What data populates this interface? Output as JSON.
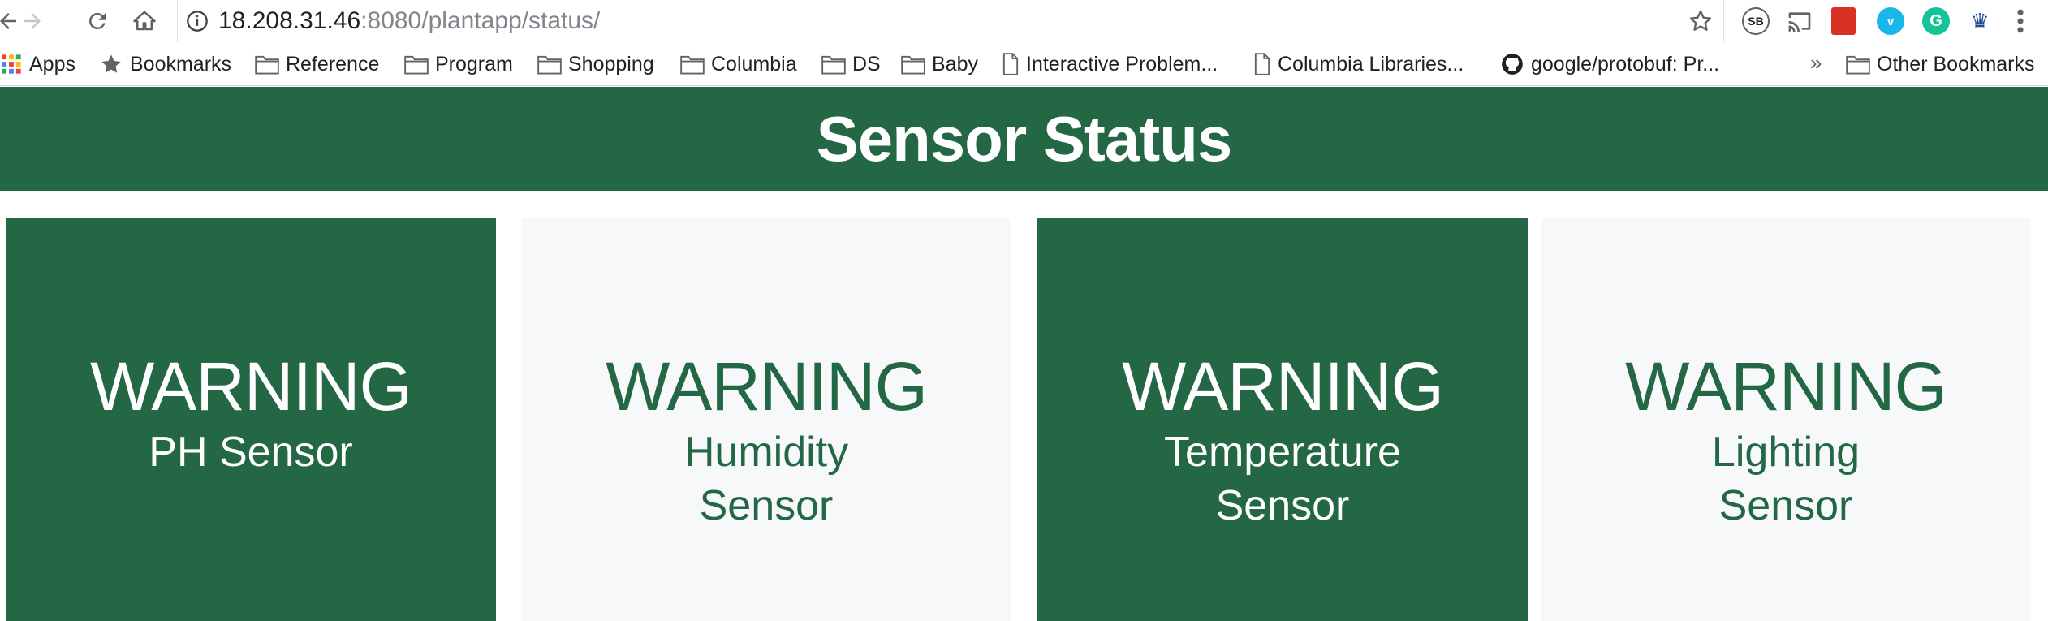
{
  "browser": {
    "url_host": "18.208.31.46",
    "url_path": ":8080/plantapp/status/",
    "extensions": [
      {
        "name": "sb-extension-icon",
        "text": "SB",
        "color": "#ffffff"
      },
      {
        "name": "cast-icon",
        "text": "",
        "color": "#5f6368"
      },
      {
        "name": "bookmark-extension-icon",
        "text": "",
        "color": "#e04a3f"
      },
      {
        "name": "vimeo-extension-icon",
        "text": "v",
        "color": "#1ab7ea"
      },
      {
        "name": "grammarly-icon",
        "text": "G",
        "color": "#15c39a"
      },
      {
        "name": "columbia-crown-icon",
        "text": "♛",
        "color": "#1d4f91"
      }
    ]
  },
  "bookmarks": {
    "apps": "Apps",
    "bookmarks": "Bookmarks",
    "reference": "Reference",
    "program": "Program",
    "shopping": "Shopping",
    "columbia": "Columbia",
    "ds": "DS",
    "baby": "Baby",
    "interactive": "Interactive Problem...",
    "columbia_libraries": "Columbia Libraries...",
    "protobuf": "google/protobuf: Pr...",
    "more": "»",
    "other": "Other Bookmarks"
  },
  "page": {
    "title": "Sensor Status",
    "accent_color": "#246745",
    "cards": [
      {
        "status": "WARNING",
        "label": "PH Sensor",
        "style": "dark"
      },
      {
        "status": "WARNING",
        "label": "Humidity Sensor",
        "style": "light"
      },
      {
        "status": "WARNING",
        "label": "Temperature Sensor",
        "style": "dark"
      },
      {
        "status": "WARNING",
        "label": "Lighting Sensor",
        "style": "light"
      }
    ]
  }
}
